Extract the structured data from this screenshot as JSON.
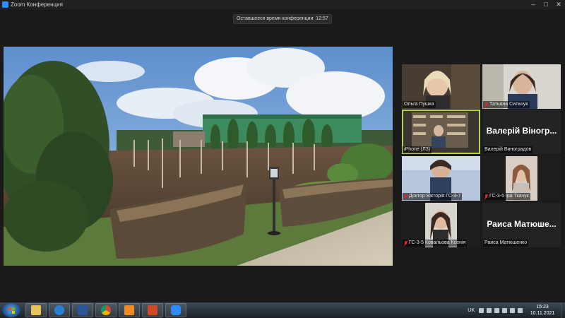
{
  "window": {
    "title": "Zoom Конференция",
    "controls": [
      "–",
      "□",
      "✕"
    ]
  },
  "timer": {
    "text": "Оставшееся время конференции: 12:57"
  },
  "shared_content": {
    "description": "vineyard"
  },
  "participants": [
    {
      "name": "Ольга Пушка",
      "video": true,
      "muted": false
    },
    {
      "name": "Татьяна Сильчук",
      "video": true,
      "muted": true
    },
    {
      "name": "iPhone (ЛЗ)",
      "video": true,
      "muted": false,
      "active_speaker": true
    },
    {
      "name": "Валерій Виноградов",
      "display_name": "Валерій Віногр...",
      "video": false,
      "muted": false
    },
    {
      "name": "Доктор Вікторія ГС-3-7",
      "video": true,
      "muted": true
    },
    {
      "name": "ГС-3-5 Іра Ткачук",
      "video": true,
      "muted": true
    },
    {
      "name": "ГС-3-5 Ковальова Ксенія",
      "video": true,
      "muted": true
    },
    {
      "name": "Раиса Матюшенко",
      "display_name": "Раиса Матюше...",
      "video": false,
      "muted": false
    }
  ],
  "taskbar": {
    "apps": [
      "explorer",
      "internet-explorer",
      "word",
      "chrome",
      "media-player",
      "powerpoint",
      "zoom"
    ],
    "language": "UK",
    "time": "15:23",
    "date": "10.11.2021"
  }
}
